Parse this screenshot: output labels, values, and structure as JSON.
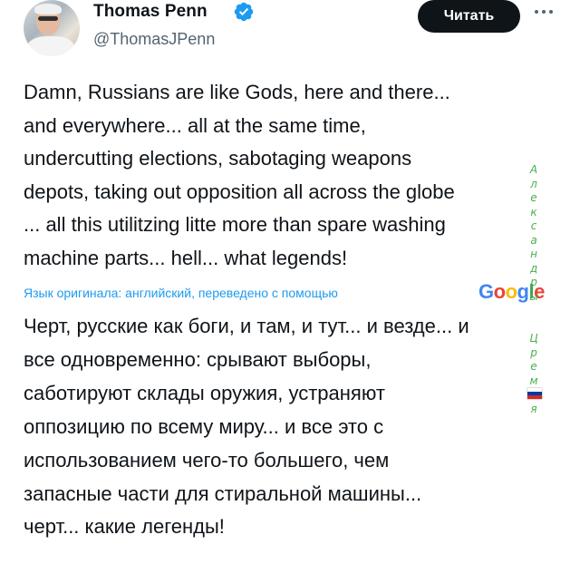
{
  "author": {
    "name": "Thomas Penn",
    "handle": "@ThomasJPenn"
  },
  "follow_button": "Читать",
  "tweet": {
    "original_lines": [
      "Damn, Russians are like Gods, here and there...",
      "and everywhere... all at the same time,",
      "undercutting elections, sabotaging weapons",
      "depots, taking out opposition all across the globe",
      "... all this utilitzing litte more than spare washing",
      "machine parts... hell... what legends!"
    ],
    "translation_note": "Язык оригинала: английский, переведено с помощью",
    "translation_provider": {
      "letters": [
        "G",
        "o",
        "o",
        "g",
        "l",
        "e"
      ],
      "colors": [
        "#4285F4",
        "#EA4335",
        "#FBBC05",
        "#4285F4",
        "#34A853",
        "#EA4335"
      ]
    },
    "translated_lines": [
      "Черт, русские как боги, и там, и тут... и везде... и",
      "все одновременно: срывают выборы,",
      "саботируют склады оружия, устраняют",
      "оппозицию по всему миру... и все это с",
      "использованием чего-то большего, чем",
      "запасные части для стиральной машины...",
      "черт... какие легенды!"
    ]
  },
  "overlay_watermark": {
    "letters": [
      "А",
      "л",
      "е",
      "к",
      "с",
      "а",
      "н",
      "д",
      "р",
      "ы",
      "",
      "",
      "Ц",
      "р",
      "е",
      "м",
      "л",
      "я"
    ],
    "color": "#4caf50"
  },
  "icons": {
    "verified": "verified-badge-icon",
    "more": "more-options-icon",
    "flag": "russian-flag-icon"
  },
  "colors": {
    "verified_blue": "#1d9bf0",
    "link_blue": "#1d9bf0",
    "button_bg": "#0f1419",
    "secondary_text": "#536471"
  }
}
